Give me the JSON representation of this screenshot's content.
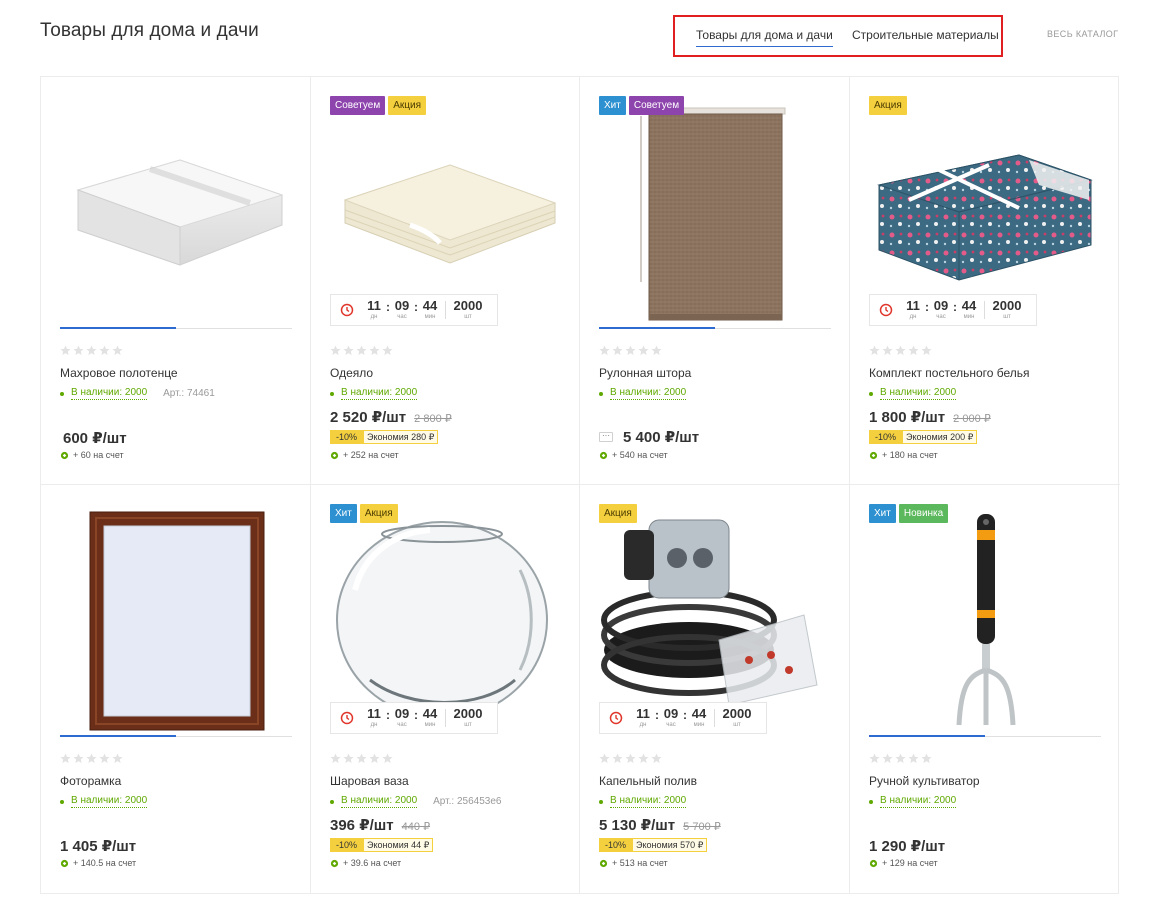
{
  "header": {
    "title": "Товары для дома и дачи",
    "tabs": [
      {
        "label": "Товары для дома и дачи",
        "active": true
      },
      {
        "label": "Строительные материалы",
        "active": false
      }
    ],
    "catalog_link": "Весь каталог"
  },
  "colors": {
    "accent": "#2d6bd1",
    "stock_green": "#5fa800",
    "sale_yellow": "#f4d03f",
    "hit_blue": "#2d91d1",
    "recommend_purple": "#8e44ad",
    "new_green": "#5cb85c",
    "highlight_red": "#e02020"
  },
  "timer_units": {
    "days": "дн",
    "hours": "час",
    "mins": "мин",
    "qty": "шт"
  },
  "products": [
    {
      "name": "Махровое полотенце",
      "badges": [],
      "stock": "В наличии: 2000",
      "article": "Арт.: 74461",
      "price": "600 ₽/шт",
      "old_price": "",
      "discount": "",
      "economy": "",
      "bonus": "+ 60 на счет",
      "timer": null,
      "image": "towel-image",
      "rating": 0
    },
    {
      "name": "Одеяло",
      "badges": [
        "Советуем",
        "Акция"
      ],
      "stock": "В наличии: 2000",
      "article": "",
      "price": "2 520 ₽/шт",
      "old_price": "2 800 ₽",
      "discount": "-10%",
      "economy": "Экономия 280 ₽",
      "bonus": "+ 252 на счет",
      "timer": {
        "days": "11",
        "hours": "09",
        "mins": "44",
        "qty": "2000"
      },
      "image": "blanket-image",
      "rating": 0
    },
    {
      "name": "Рулонная штора",
      "badges": [
        "Хит",
        "Советуем"
      ],
      "stock": "В наличии: 2000",
      "article": "",
      "price": "5 400 ₽/шт",
      "old_price": "",
      "discount": "",
      "economy": "",
      "bonus": "+ 540 на счет",
      "timer": null,
      "more": "···",
      "image": "roller-blind-image",
      "rating": 0
    },
    {
      "name": "Комплект постельного белья",
      "badges": [
        "Акция"
      ],
      "stock": "В наличии: 2000",
      "article": "",
      "price": "1 800 ₽/шт",
      "old_price": "2 000 ₽",
      "discount": "-10%",
      "economy": "Экономия 200 ₽",
      "bonus": "+ 180 на счет",
      "timer": {
        "days": "11",
        "hours": "09",
        "mins": "44",
        "qty": "2000"
      },
      "image": "bedding-set-image",
      "rating": 0
    },
    {
      "name": "Фоторамка",
      "badges": [],
      "stock": "В наличии: 2000",
      "article": "",
      "price": "1 405 ₽/шт",
      "old_price": "",
      "discount": "",
      "economy": "",
      "bonus": "+ 140.5 на счет",
      "timer": null,
      "image": "photo-frame-image",
      "rating": 0
    },
    {
      "name": "Шаровая ваза",
      "badges": [
        "Хит",
        "Акция"
      ],
      "stock": "В наличии: 2000",
      "article": "Арт.: 256453е6",
      "price": "396 ₽/шт",
      "old_price": "440 ₽",
      "discount": "-10%",
      "economy": "Экономия 44 ₽",
      "bonus": "+ 39.6 на счет",
      "timer": {
        "days": "11",
        "hours": "09",
        "mins": "44",
        "qty": "2000"
      },
      "image": "glass-vase-image",
      "rating": 0
    },
    {
      "name": "Капельный полив",
      "badges": [
        "Акция"
      ],
      "stock": "В наличии: 2000",
      "article": "",
      "price": "5 130 ₽/шт",
      "old_price": "5 700 ₽",
      "discount": "-10%",
      "economy": "Экономия 570 ₽",
      "bonus": "+ 513 на счет",
      "timer": {
        "days": "11",
        "hours": "09",
        "mins": "44",
        "qty": "2000"
      },
      "image": "drip-irrigation-image",
      "rating": 0
    },
    {
      "name": "Ручной культиватор",
      "badges": [
        "Хит",
        "Новинка"
      ],
      "stock": "В наличии: 2000",
      "article": "",
      "price": "1 290 ₽/шт",
      "old_price": "",
      "discount": "",
      "economy": "",
      "bonus": "+ 129 на счет",
      "timer": null,
      "image": "hand-cultivator-image",
      "rating": 0
    }
  ]
}
